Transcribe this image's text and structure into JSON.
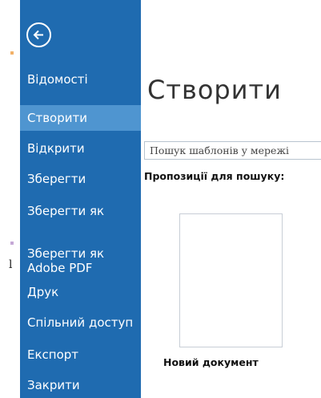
{
  "sidebar": {
    "items": [
      {
        "label": "Відомості"
      },
      {
        "label": "Створити"
      },
      {
        "label": "Відкрити"
      },
      {
        "label": "Зберегти"
      },
      {
        "label": "Зберегти як"
      },
      {
        "label": "Зберегти як\nAdobe PDF"
      },
      {
        "label": "Друк"
      },
      {
        "label": "Спільний доступ"
      },
      {
        "label": "Експорт"
      },
      {
        "label": "Закрити"
      }
    ],
    "active_label": "Створити",
    "background": "#1f6bb0",
    "active_background": "#4f95d0"
  },
  "main": {
    "title": "Створити",
    "search_value": "Пошук шаблонів у мережі",
    "suggestions_label": "Пропозиції для пошуку:",
    "templates": [
      {
        "label": "Новий документ"
      }
    ]
  },
  "margin_letter": "l"
}
